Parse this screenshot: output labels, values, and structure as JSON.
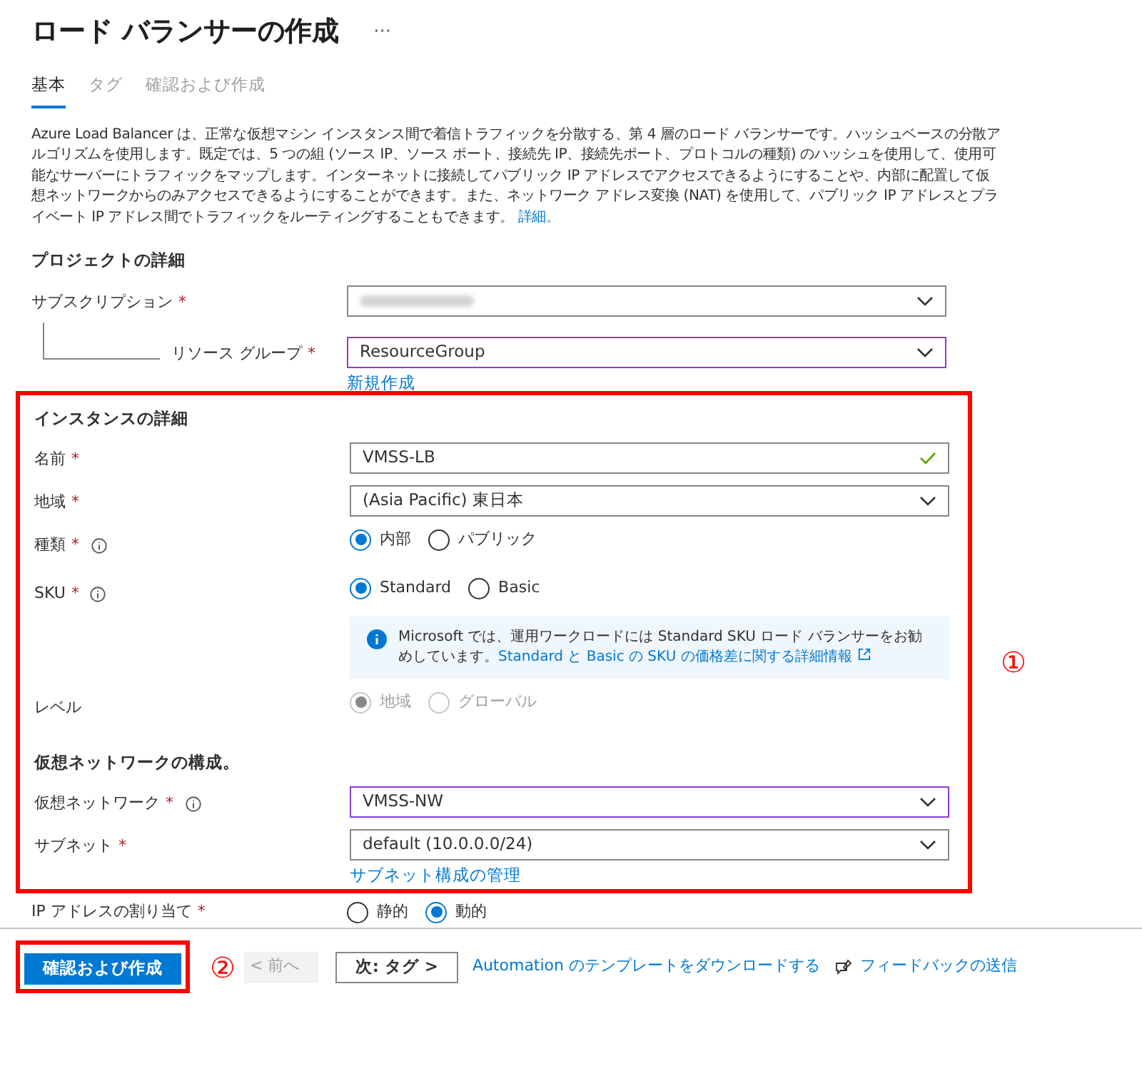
{
  "title": "ロード バランサーの作成",
  "more_menu": "···",
  "required_mark": "*",
  "tabs": [
    {
      "label": "基本",
      "selected": true
    },
    {
      "label": "タグ",
      "selected": false
    },
    {
      "label": "確認および作成",
      "selected": false
    }
  ],
  "description": {
    "text": "Azure Load Balancer は、正常な仮想マシン インスタンス間で着信トラフィックを分散する、第 4 層のロード バランサーです。ハッシュベースの分散アルゴリズムを使用します。既定では、5 つの組 (ソース IP、ソース ポート、接続先 IP、接続先ポート、プロトコルの種類) のハッシュを使用して、使用可能なサーバーにトラフィックをマップします。インターネットに接続してパブリック IP アドレスでアクセスできるようにすることや、内部に配置して仮想ネットワークからのみアクセスできるようにすることができます。また、ネットワーク アドレス変換 (NAT) を使用して、パブリック IP アドレスとプライベート IP アドレス間でトラフィックをルーティングすることもできます。",
    "link": "詳細。"
  },
  "project": {
    "heading": "プロジェクトの詳細",
    "rows": [
      {
        "kind": "blurred",
        "label": "サブスクリプション",
        "required": true,
        "info": false,
        "nested": false,
        "focused": false
      },
      {
        "kind": "select",
        "label": "リソース グループ",
        "required": true,
        "info": false,
        "nested": true,
        "focused": true,
        "value": "ResourceGroup",
        "link": "新規作成"
      }
    ]
  },
  "instance": {
    "annotation": "①",
    "heading": "インスタンスの詳細",
    "rows": [
      {
        "kind": "text",
        "label": "名前",
        "required": true,
        "info": false,
        "value": "VMSS-LB",
        "valid": true,
        "focused": false
      },
      {
        "kind": "select",
        "label": "地域",
        "required": true,
        "info": false,
        "value": "(Asia Pacific) 東日本",
        "focused": false
      },
      {
        "kind": "radio",
        "label": "種類",
        "required": true,
        "info": true,
        "disabled": false,
        "options": [
          {
            "label": "内部",
            "selected": true
          },
          {
            "label": "パブリック",
            "selected": false
          }
        ]
      },
      {
        "kind": "radio",
        "label": "SKU",
        "required": true,
        "info": true,
        "disabled": false,
        "options": [
          {
            "label": "Standard",
            "selected": true
          },
          {
            "label": "Basic",
            "selected": false
          }
        ]
      },
      {
        "kind": "notice",
        "text": "Microsoft では、運用ワークロードには Standard SKU ロード バランサーをお勧めしています。",
        "link": "Standard と Basic の SKU の価格差に関する詳細情報"
      },
      {
        "kind": "radio",
        "label": "レベル",
        "required": false,
        "info": false,
        "disabled": true,
        "options": [
          {
            "label": "地域",
            "selected": true
          },
          {
            "label": "グローバル",
            "selected": false
          }
        ]
      },
      {
        "kind": "heading",
        "text": "仮想ネットワークの構成。"
      },
      {
        "kind": "select",
        "label": "仮想ネットワーク",
        "required": true,
        "info": true,
        "value": "VMSS-NW",
        "focused": true
      },
      {
        "kind": "select",
        "label": "サブネット",
        "required": true,
        "info": false,
        "value": "default (10.0.0.0/24)",
        "focused": false,
        "link": "サブネット構成の管理"
      }
    ]
  },
  "ip_assignment": {
    "label": "IP アドレスの割り当て",
    "required": true,
    "options": [
      {
        "label": "静的",
        "selected": false
      },
      {
        "label": "動的",
        "selected": true
      }
    ]
  },
  "footer": {
    "primary": "確認および作成",
    "annotation": "②",
    "previous": {
      "label": "< 前へ",
      "disabled": true
    },
    "next": "次: タグ >",
    "download_link": "Automation のテンプレートをダウンロードする",
    "feedback_link": "フィードバックの送信"
  }
}
